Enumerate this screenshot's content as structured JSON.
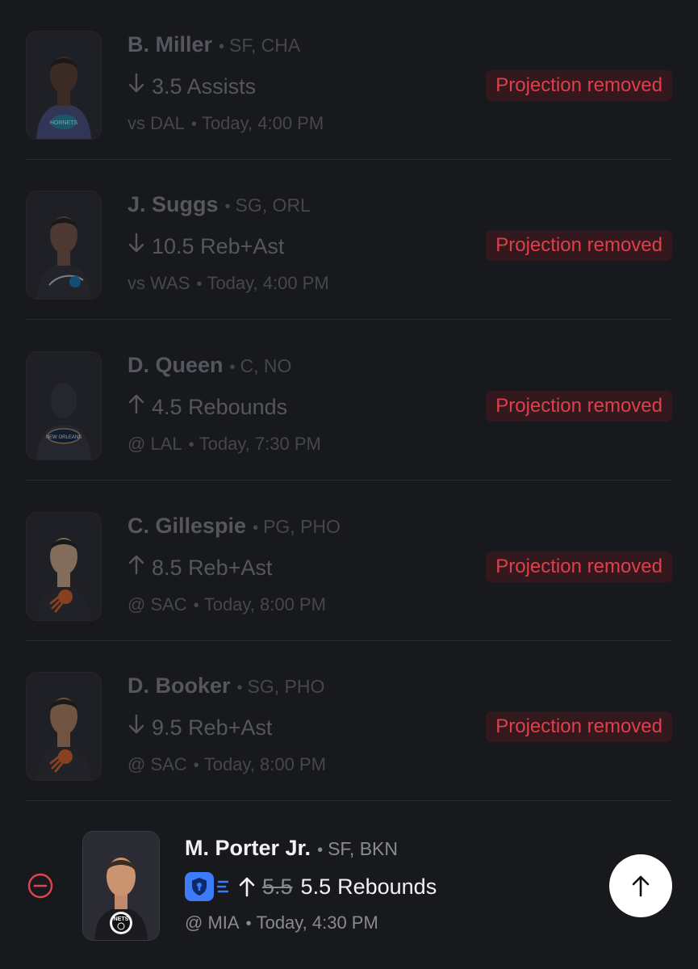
{
  "removed_rows": [
    {
      "name": "B. Miller",
      "position_team": "SF, CHA",
      "direction": "down",
      "line": "3.5",
      "stat": "Assists",
      "game": "vs DAL",
      "time": "Today, 4:00 PM",
      "status": "Projection removed",
      "team_logo": "hornets-logo",
      "jersey_color": "#4a4d86"
    },
    {
      "name": "J. Suggs",
      "position_team": "SG, ORL",
      "direction": "down",
      "line": "10.5",
      "stat": "Reb+Ast",
      "game": "vs WAS",
      "time": "Today, 4:00 PM",
      "status": "Projection removed",
      "team_logo": "magic-logo",
      "jersey_color": "#2c2d33"
    },
    {
      "name": "D. Queen",
      "position_team": "C, NO",
      "direction": "up",
      "line": "4.5",
      "stat": "Rebounds",
      "game": "@ LAL",
      "time": "Today, 7:30 PM",
      "status": "Projection removed",
      "team_logo": "pelicans-logo",
      "jersey_color": "#2b3447"
    },
    {
      "name": "C. Gillespie",
      "position_team": "PG, PHO",
      "direction": "up",
      "line": "8.5",
      "stat": "Reb+Ast",
      "game": "@ SAC",
      "time": "Today, 8:00 PM",
      "status": "Projection removed",
      "team_logo": "suns-logo",
      "jersey_color": "#2a2a30"
    },
    {
      "name": "D. Booker",
      "position_team": "SG, PHO",
      "direction": "down",
      "line": "9.5",
      "stat": "Reb+Ast",
      "game": "@ SAC",
      "time": "Today, 8:00 PM",
      "status": "Projection removed",
      "team_logo": "suns-logo",
      "jersey_color": "#2a2a30"
    }
  ],
  "active_row": {
    "name": "M. Porter Jr.",
    "position_team": "SF, BKN",
    "direction": "up",
    "old_line": "5.5",
    "new_line": "5.5",
    "stat": "Rebounds",
    "game": "@ MIA",
    "time": "Today, 4:30 PM",
    "team_logo": "nets-logo",
    "team_logo_text": "NETS"
  },
  "separator": "•",
  "colors": {
    "background": "#18191d",
    "removed_text": "#df3f4b",
    "removed_bg": "#33191e",
    "accent_blue": "#3d7bfa"
  },
  "icons": {
    "remove": "minus-circle-icon",
    "scroll_top": "arrow-up-icon",
    "lock_badge": "shield-lock-icon"
  }
}
